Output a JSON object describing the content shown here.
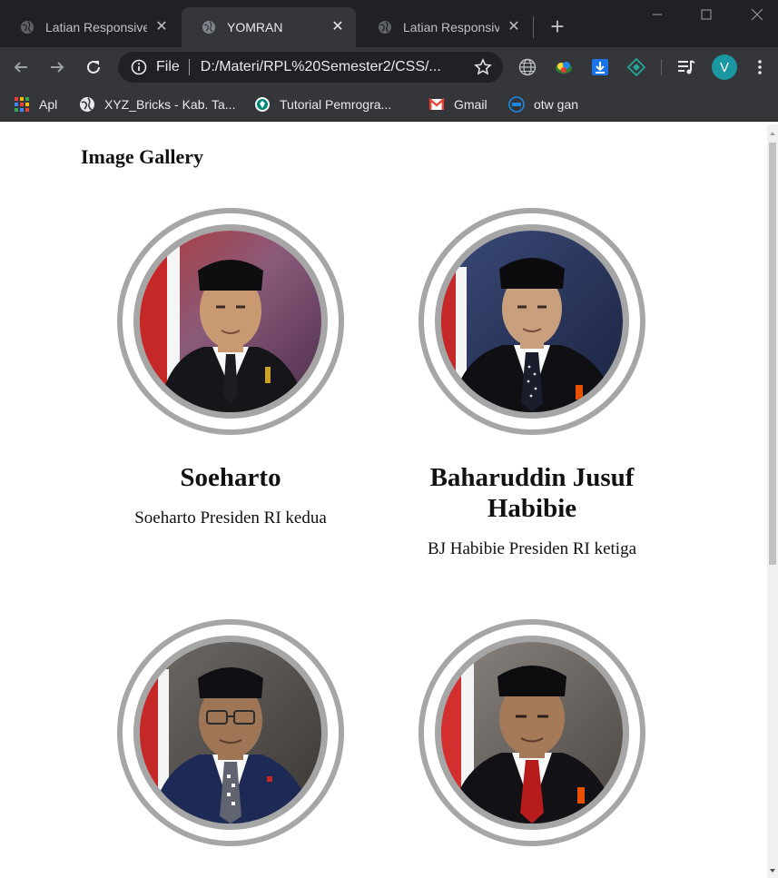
{
  "browser": {
    "tabs": [
      {
        "title": "Latian Responsive",
        "active": false
      },
      {
        "title": "YOMRAN",
        "active": true
      },
      {
        "title": "Latian Responsive",
        "active": false
      }
    ],
    "address": {
      "scheme": "File",
      "url": "D:/Materi/RPL%20Semester2/CSS/..."
    },
    "profile_initial": "V",
    "bookmarks": [
      {
        "label": "Apl",
        "icon": "apps-grid-icon"
      },
      {
        "label": "XYZ_Bricks - Kab. Ta...",
        "icon": "globe-icon"
      },
      {
        "label": "Tutorial Pemrogra...",
        "icon": "site-logo-icon"
      },
      {
        "label": "Gmail",
        "icon": "gmail-icon"
      },
      {
        "label": "otw gan",
        "icon": "dell-icon"
      }
    ]
  },
  "page": {
    "title": "Image Gallery",
    "gallery": [
      {
        "name": "Soeharto",
        "description": "Soeharto Presiden RI kedua"
      },
      {
        "name": "Baharuddin Jusuf Habibie",
        "description": "BJ Habibie Presiden RI ketiga"
      },
      {
        "name": "",
        "description": ""
      },
      {
        "name": "",
        "description": ""
      }
    ]
  },
  "colors": {
    "tabstrip": "#202124",
    "toolbar": "#35363a",
    "frame_ring": "#a6a6a6",
    "avatar": "#1a97a0"
  }
}
